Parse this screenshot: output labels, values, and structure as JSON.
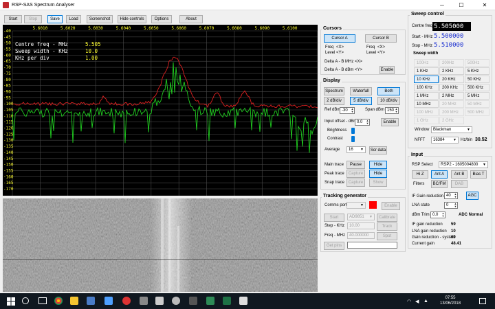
{
  "window": {
    "title": "RSP-SAS Spectrum Analyser",
    "min": "─",
    "max": "☐",
    "close": "✕"
  },
  "toolbar": {
    "start": "Start",
    "stop": "Stop",
    "save": "Save",
    "load": "Load",
    "screenshot": "Screenshot",
    "hide_controls": "Hide controls",
    "options": "Options",
    "about": "About"
  },
  "spectrum": {
    "freq_ticks": [
      "5.6010",
      "5.6020",
      "5.6030",
      "5.6040",
      "5.6050",
      "5.6060",
      "5.6070",
      "5.6080",
      "5.6090",
      "5.6100"
    ],
    "db_ticks": [
      "-40",
      "-45",
      "-50",
      "-55",
      "-60",
      "-65",
      "-70",
      "-75",
      "-80",
      "-85",
      "-90",
      "-95",
      "-100",
      "-105",
      "-110",
      "-115",
      "-120",
      "-125",
      "-130",
      "-135",
      "-140",
      "-145",
      "-150",
      "-155",
      "-160",
      "-165",
      "-170"
    ],
    "info": {
      "centre_label": "Centre freq - MHz",
      "centre_val": "5.505",
      "sweep_label": "Sweep width - KHz",
      "sweep_val": "10.0",
      "div_label": "KHz per div",
      "div_val": "1.00"
    }
  },
  "cursors": {
    "title": "Cursors",
    "cursor_a": "Cursor A",
    "cursor_b": "Cursor B",
    "freq": "Freq",
    "level": "Level",
    "freq_val_a": "<X>",
    "level_val_a": "<Y>",
    "freq_val_b": "<X>",
    "level_val_b": "<Y>",
    "delta_freq": "Delta A - B MHz",
    "delta_freq_val": "<X>",
    "delta_level": "Delta A - B dBm",
    "delta_level_val": "<Y>",
    "enable": "Enable"
  },
  "display": {
    "title": "Display",
    "spectrum": "Spectrum",
    "waterfall": "Waterfall",
    "both": "Both",
    "div2": "2 dB/div",
    "div5": "5 dB/div",
    "div10": "10 dB/div",
    "ref_label": "Ref dBm",
    "ref_val": "-30",
    "span_label": "Span dBm",
    "span_val": "150",
    "offset_label": "Input offset - dBm",
    "offset_val": "0.0",
    "enable": "Enable",
    "brightness": "Brightness",
    "contrast": "Contrast",
    "average": "Average",
    "average_val": "16",
    "scr_data": "Scr data",
    "main_trace": "Main trace",
    "peak_trace": "Peak trace",
    "snap_trace": "Snap trace",
    "pause": "Pause",
    "hide": "Hide",
    "capture": "Capture",
    "show": "Show"
  },
  "tracking": {
    "title": "Tracking generator",
    "comms_port": "Comms port",
    "enable": "Enable",
    "start": "Start",
    "device": "AD9851",
    "calibrate": "Calibrate",
    "step_label": "Step - KHz",
    "step_val": "10.00",
    "track": "Track",
    "freq_label": "Freq - MHz",
    "freq_val": "40.000000",
    "spot": "Spot",
    "get_pins": "Get pins"
  },
  "sweep": {
    "title": "Sweep control",
    "centre_label": "Centre freq",
    "centre_val": "5.505000",
    "start_label": "Start - MHz",
    "start_val": "5.500000",
    "stop_label": "Stop - MHz",
    "stop_val": "5.510000",
    "width_title": "Sweep width",
    "widths": [
      "100Hz",
      "200Hz",
      "500Hz",
      "1 KHz",
      "2 KHz",
      "5 KHz",
      "10 KHz",
      "20 KHz",
      "50 KHz",
      "100 KHz",
      "200 KHz",
      "500 KHz",
      "1 MHz",
      "2 MHz",
      "5 MHz",
      "10 MHz",
      "20 MHz",
      "50 MHz",
      "100 MHz",
      "200 MHz",
      "500 MHz",
      "1 GHz",
      "2 GHz"
    ],
    "window_label": "Window",
    "window_val": "Blackman",
    "nfft_label": "NFFT",
    "nfft_val": "16384",
    "hzbin_label": "Hz/bin",
    "hzbin_val": "30.52"
  },
  "input": {
    "title": "Input",
    "rsp_label": "RSP Select",
    "rsp_val": "RSP2 - 1605004800",
    "hiz": "Hi Z",
    "ant_a": "Ant A",
    "ant_b": "Ant B",
    "bias_t": "Bias T",
    "filters": "Filters",
    "bcfm": "BC/FM",
    "dab": "DAB",
    "if_label": "IF Gain reduction",
    "if_val": "40",
    "agc": "AGC",
    "lna_label": "LNA state",
    "lna_val": "0",
    "trim_label": "dBm Trim",
    "trim_val": "0.0",
    "adc": "ADC Normal",
    "if_red_label": "IF gain reduction",
    "if_red_val": "59",
    "lna_red_label": "LNA gain reduction",
    "lna_red_val": "10",
    "sys_label": "Gain reduction - system",
    "sys_val": "69",
    "cur_label": "Current gain",
    "cur_val": "48.41"
  },
  "taskbar": {
    "time": "07:55",
    "date": "13/06/2018"
  },
  "colors": {
    "peak": "#e02020",
    "main": "#20d020",
    "grid": "#4a4a4a",
    "label": "#ffff30",
    "selected": "#0078d7"
  }
}
